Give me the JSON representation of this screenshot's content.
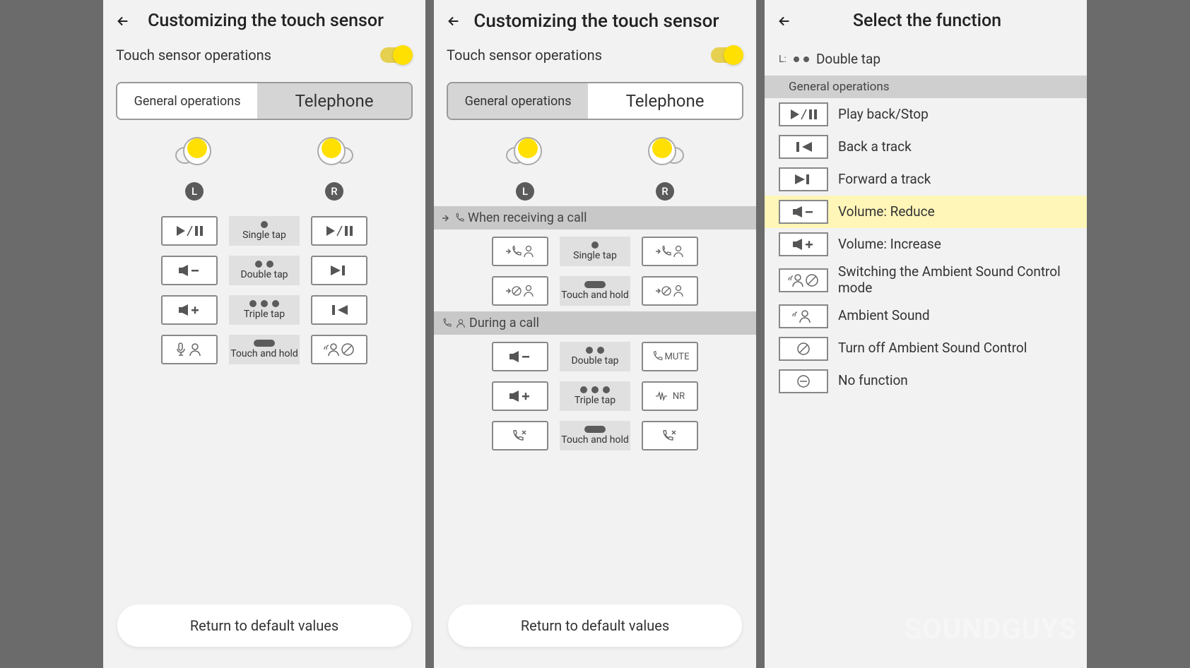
{
  "screen1": {
    "title": "Customizing the touch sensor",
    "subhead": "Touch sensor operations",
    "tabs": {
      "general": "General operations",
      "telephone": "Telephone"
    },
    "active_tab": "telephone",
    "buds": {
      "left": "L",
      "right": "R"
    },
    "gestures": {
      "single": "Single tap",
      "double": "Double tap",
      "triple": "Triple tap",
      "hold": "Touch and hold"
    },
    "assignments": {
      "single": {
        "l": "play-pause",
        "r": "play-pause"
      },
      "double": {
        "l": "volume-down",
        "r": "next-track"
      },
      "triple": {
        "l": "volume-up",
        "r": "prev-track"
      },
      "hold": {
        "l": "mic-person",
        "r": "ambient-off"
      }
    },
    "footer": "Return to default values"
  },
  "screen2": {
    "title": "Customizing the touch sensor",
    "subhead": "Touch sensor operations",
    "tabs": {
      "general": "General operations",
      "telephone": "Telephone"
    },
    "active_tab": "general",
    "buds": {
      "left": "L",
      "right": "R"
    },
    "sections": {
      "receiving": "When receiving a call",
      "during": "During a call"
    },
    "gestures": {
      "single": "Single tap",
      "double": "Double tap",
      "triple": "Triple tap",
      "hold": "Touch and hold"
    },
    "receiving_rows": {
      "single": {
        "l": "answer",
        "r": "answer"
      },
      "hold": {
        "l": "decline",
        "r": "decline"
      }
    },
    "during_rows": {
      "double": {
        "l": "volume-down",
        "r": "mute",
        "r_text": "MUTE"
      },
      "triple": {
        "l": "volume-up",
        "r": "nr",
        "r_text": "NR"
      },
      "hold": {
        "l": "end-call",
        "r": "end-call"
      }
    },
    "footer": "Return to default values"
  },
  "screen3": {
    "title": "Select the function",
    "context": {
      "side": "L:",
      "gesture": "Double tap"
    },
    "list_header": "General operations",
    "functions": [
      {
        "id": "play-stop",
        "label": "Play back/Stop"
      },
      {
        "id": "back-track",
        "label": "Back a track"
      },
      {
        "id": "forward-track",
        "label": "Forward a track"
      },
      {
        "id": "vol-reduce",
        "label": "Volume: Reduce",
        "selected": true
      },
      {
        "id": "vol-increase",
        "label": "Volume: Increase"
      },
      {
        "id": "ambient-switch",
        "label": "Switching the Ambient Sound Control mode"
      },
      {
        "id": "ambient-sound",
        "label": "Ambient Sound"
      },
      {
        "id": "ambient-off",
        "label": "Turn off Ambient Sound Control"
      },
      {
        "id": "no-function",
        "label": "No function"
      }
    ]
  },
  "watermark": "SOUNDGUYS"
}
